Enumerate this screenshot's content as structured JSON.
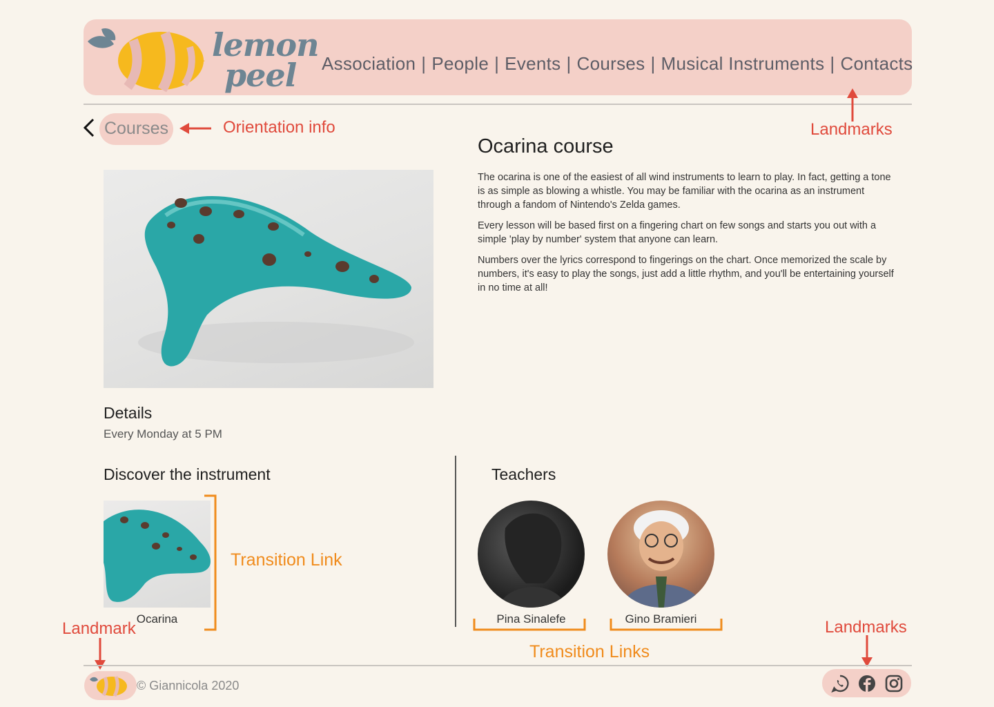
{
  "brand": {
    "logo_line1": "lemon",
    "logo_line2": "peel"
  },
  "nav": {
    "items": [
      {
        "label": "Association"
      },
      {
        "label": "People"
      },
      {
        "label": "Events"
      },
      {
        "label": "Courses"
      },
      {
        "label": "Musical Instruments"
      },
      {
        "label": "Contacts"
      }
    ],
    "separator": "|"
  },
  "breadcrumb": {
    "label": "Courses"
  },
  "course": {
    "title": "Ocarina course",
    "paragraphs": [
      "The ocarina is one of the easiest of all wind instruments to learn to play. In fact, getting a tone is as simple as blowing a whistle. You may be familiar with the ocarina as an instrument through a fandom of Nintendo's Zelda games.",
      "Every lesson will be based first on a fingering chart on few songs and starts you out with a simple 'play by number' system that anyone can learn.",
      "Numbers over the lyrics correspond to fingerings on the chart. Once memorized the scale by numbers, it's easy to play the songs, just add a little rhythm, and you'll be entertaining yourself in no time at all!"
    ],
    "details_heading": "Details",
    "details_text": "Every Monday at 5 PM",
    "discover_heading": "Discover the instrument",
    "instrument_label": "Ocarina",
    "teachers_heading": "Teachers",
    "teachers": [
      {
        "name": "Pina Sinalefe"
      },
      {
        "name": "Gino Bramieri"
      }
    ]
  },
  "footer": {
    "copyright": "© Giannicola 2020",
    "social": [
      "whatsapp-icon",
      "facebook-icon",
      "instagram-icon"
    ]
  },
  "annotations": {
    "orientation": "Orientation info",
    "landmarks_top": "Landmarks",
    "landmark_footer": "Landmark",
    "landmarks_footer": "Landmarks",
    "transition_link": "Transition Link",
    "transition_links": "Transition Links"
  },
  "colors": {
    "background": "#f9f4ec",
    "accent_pink": "#f4d0c8",
    "annotation_red": "#e04a3c",
    "annotation_orange": "#f08b1c",
    "logo_yellow": "#f6b91e",
    "logo_slate": "#6d8593"
  }
}
